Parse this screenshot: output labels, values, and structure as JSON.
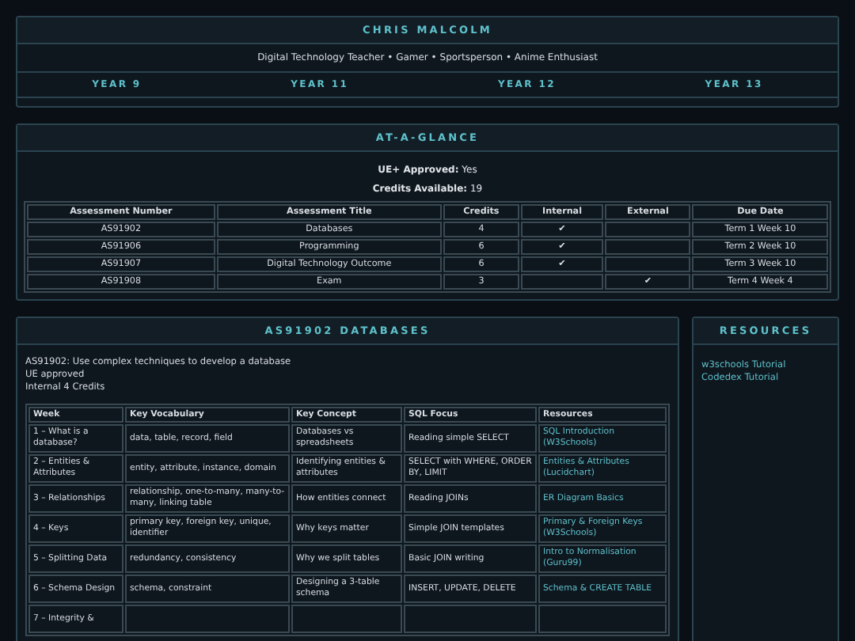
{
  "header": {
    "title": "CHRIS MALCOLM",
    "subtitle": "Digital Technology Teacher • Gamer • Sportsperson • Anime Enthusiast",
    "years": [
      "YEAR 9",
      "YEAR 11",
      "YEAR 12",
      "YEAR 13"
    ]
  },
  "glance": {
    "title": "AT-A-GLANCE",
    "facts": [
      {
        "label": "UE+ Approved:",
        "value": "Yes"
      },
      {
        "label": "Credits Available:",
        "value": "19"
      }
    ],
    "columns": [
      "Assessment Number",
      "Assessment Title",
      "Credits",
      "Internal",
      "External",
      "Due Date"
    ],
    "rows": [
      {
        "number": "AS91902",
        "title": "Databases",
        "credits": "4",
        "internal": true,
        "external": false,
        "due": "Term 1 Week 10"
      },
      {
        "number": "AS91906",
        "title": "Programming",
        "credits": "6",
        "internal": true,
        "external": false,
        "due": "Term 2 Week 10"
      },
      {
        "number": "AS91907",
        "title": "Digital Technology Outcome",
        "credits": "6",
        "internal": true,
        "external": false,
        "due": "Term 3 Week 10"
      },
      {
        "number": "AS91908",
        "title": "Exam",
        "credits": "3",
        "internal": false,
        "external": true,
        "due": "Term 4 Week 4"
      }
    ],
    "tick": "✔"
  },
  "unit": {
    "title": "AS91902 DATABASES",
    "lines": [
      "AS91902: Use complex techniques to develop a database",
      "UE approved",
      "Internal 4 Credits"
    ],
    "columns": [
      "Week",
      "Key Vocabulary",
      "Key Concept",
      "SQL Focus",
      "Resources"
    ],
    "rows": [
      [
        "1 – What is a database?",
        "data, table, record, field",
        "Databases vs spreadsheets",
        "Reading simple SELECT",
        "SQL Introduction (W3Schools)"
      ],
      [
        "2 – Entities & Attributes",
        "entity, attribute, instance, domain",
        "Identifying entities & attributes",
        "SELECT with WHERE, ORDER BY, LIMIT",
        "Entities & Attributes (Lucidchart)"
      ],
      [
        "3 – Relationships",
        "relationship, one-to-many, many-to-many, linking table",
        "How entities connect",
        "Reading JOINs",
        "ER Diagram Basics"
      ],
      [
        "4 – Keys",
        "primary key, foreign key, unique, identifier",
        "Why keys matter",
        "Simple JOIN templates",
        "Primary & Foreign Keys (W3Schools)"
      ],
      [
        "5 – Splitting Data",
        "redundancy, consistency",
        "Why we split tables",
        "Basic JOIN writing",
        "Intro to Normalisation (Guru99)"
      ],
      [
        "6 – Schema Design",
        "schema, constraint",
        "Designing a 3-table schema",
        "INSERT, UPDATE, DELETE",
        "Schema & CREATE TABLE"
      ],
      [
        "7 – Integrity &",
        "",
        "",
        "",
        ""
      ]
    ]
  },
  "resources": {
    "title": "RESOURCES",
    "links": [
      "w3schools Tutorial",
      "Codedex Tutorial"
    ]
  }
}
